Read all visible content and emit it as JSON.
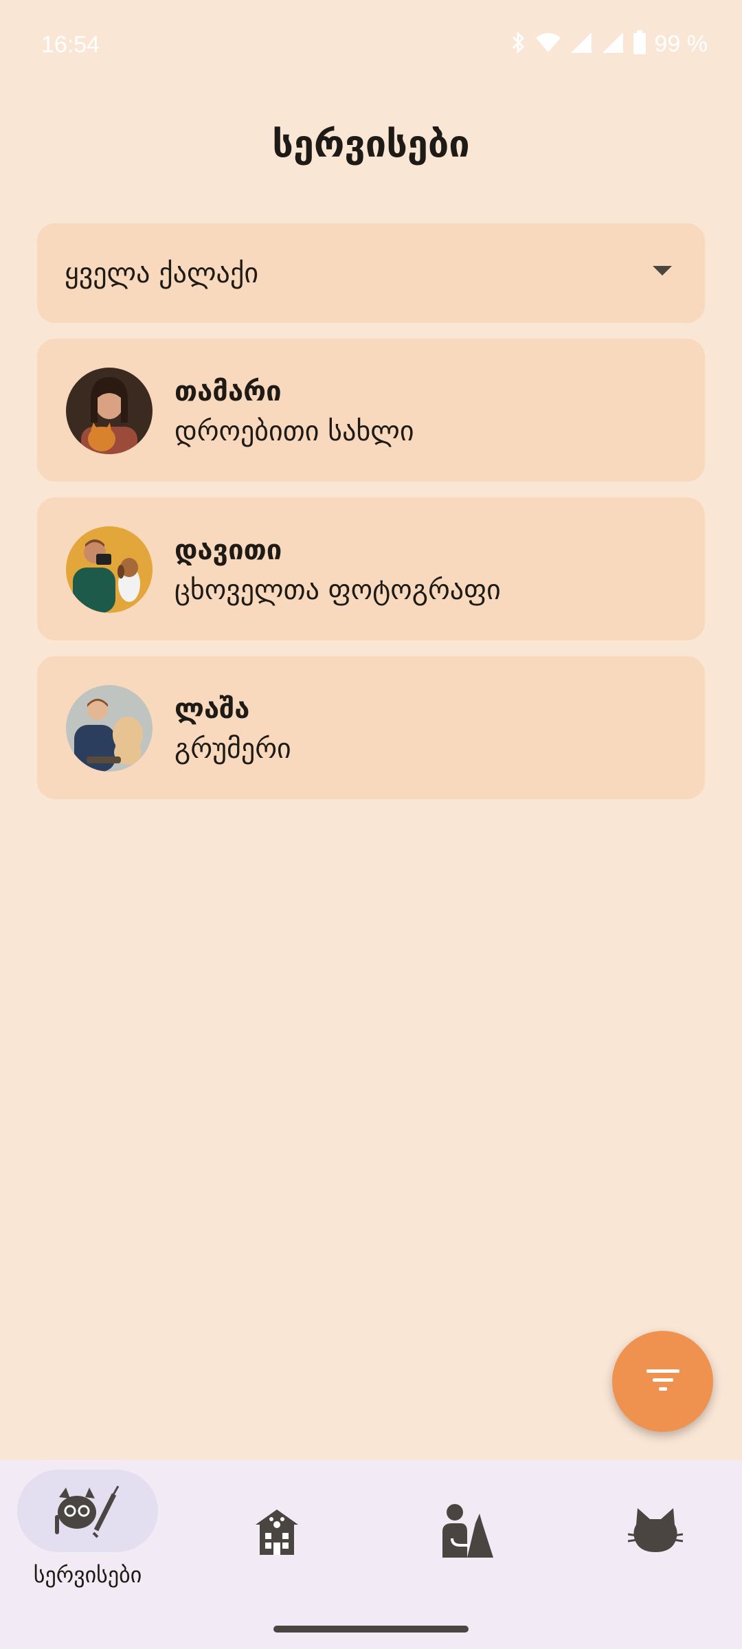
{
  "status_bar": {
    "time": "16:54",
    "battery": "99 %",
    "icons": [
      "bluetooth-icon",
      "wifi-icon",
      "signal-icon",
      "battery-icon"
    ]
  },
  "page": {
    "title": "სერვისები"
  },
  "city_filter": {
    "selected": "ყველა ქალაქი"
  },
  "services": [
    {
      "name": "თამარი",
      "role": "დროებითი სახლი",
      "avatar": "avatar-woman-with-cat"
    },
    {
      "name": "დავითი",
      "role": "ცხოველთა ფოტოგრაფი",
      "avatar": "avatar-man-with-camera-and-dog"
    },
    {
      "name": "ლაშა",
      "role": "გრუმერი",
      "avatar": "avatar-boy-grooming-dog"
    }
  ],
  "fab": {
    "icon": "filter-icon"
  },
  "bottom_nav": {
    "items": [
      {
        "label": "სერვისები",
        "icon": "services-cat-icon",
        "selected": true
      },
      {
        "label": "",
        "icon": "pet-shelter-icon",
        "selected": false
      },
      {
        "label": "",
        "icon": "pet-sitter-icon",
        "selected": false
      },
      {
        "label": "",
        "icon": "cat-icon",
        "selected": false
      }
    ]
  },
  "colors": {
    "background": "#FAE6D5",
    "card": "#F9D9BD",
    "fab": "#F0924F",
    "nav_background": "#F2EAF4",
    "nav_selected_pill": "#E4DEF1",
    "text": "#1E1B16",
    "icon_dark": "#4A4541"
  }
}
